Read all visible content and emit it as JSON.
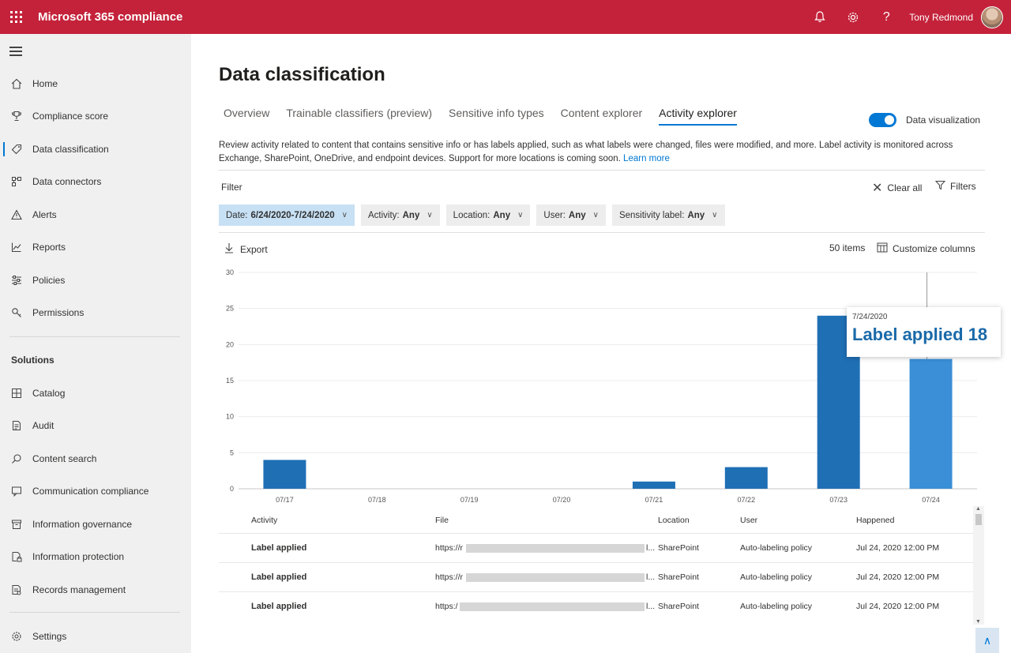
{
  "topbar": {
    "app_title": "Microsoft 365 compliance",
    "user_name": "Tony Redmond",
    "icons": [
      "waffle-icon",
      "bell-icon",
      "gear-icon",
      "help-icon"
    ]
  },
  "sidebar": {
    "items": [
      {
        "label": "Home",
        "icon": "home-icon"
      },
      {
        "label": "Compliance score",
        "icon": "trophy-icon"
      },
      {
        "label": "Data classification",
        "icon": "tag-icon",
        "active": true
      },
      {
        "label": "Data connectors",
        "icon": "connector-icon"
      },
      {
        "label": "Alerts",
        "icon": "warning-icon"
      },
      {
        "label": "Reports",
        "icon": "chart-line-icon"
      },
      {
        "label": "Policies",
        "icon": "sliders-icon"
      },
      {
        "label": "Permissions",
        "icon": "key-icon"
      }
    ],
    "solutions_label": "Solutions",
    "solutions": [
      {
        "label": "Catalog",
        "icon": "catalog-icon"
      },
      {
        "label": "Audit",
        "icon": "audit-icon"
      },
      {
        "label": "Content search",
        "icon": "search-icon"
      },
      {
        "label": "Communication compliance",
        "icon": "chat-icon"
      },
      {
        "label": "Information governance",
        "icon": "archive-icon"
      },
      {
        "label": "Information protection",
        "icon": "lock-doc-icon"
      },
      {
        "label": "Records management",
        "icon": "records-icon"
      }
    ],
    "settings": {
      "label": "Settings",
      "icon": "gear-icon"
    }
  },
  "main": {
    "title": "Data classification",
    "tabs": [
      {
        "label": "Overview"
      },
      {
        "label": "Trainable classifiers (preview)"
      },
      {
        "label": "Sensitive info types"
      },
      {
        "label": "Content explorer"
      },
      {
        "label": "Activity explorer",
        "active": true
      }
    ],
    "toggle_label": "Data visualization",
    "toggle_on": true,
    "description": "Review activity related to content that contains sensitive info or has labels applied, such as what labels were changed, files were modified, and more. Label activity is monitored across Exchange, SharePoint, OneDrive, and endpoint devices. Support for more locations is coming soon.",
    "learn_more": "Learn more",
    "filter_label": "Filter",
    "clear_all": "Clear all",
    "filters": "Filters",
    "chips": [
      {
        "label": "Date:",
        "value": "6/24/2020-7/24/2020"
      },
      {
        "label": "Activity:",
        "value": "Any"
      },
      {
        "label": "Location:",
        "value": "Any"
      },
      {
        "label": "User:",
        "value": "Any"
      },
      {
        "label": "Sensitivity label:",
        "value": "Any"
      }
    ],
    "export": "Export",
    "items_count": "50 items",
    "customize_columns": "Customize columns",
    "tooltip": {
      "date": "7/24/2020",
      "text": "Label applied 18"
    }
  },
  "chart_data": {
    "type": "bar",
    "categories": [
      "07/17",
      "07/18",
      "07/19",
      "07/20",
      "07/21",
      "07/22",
      "07/23",
      "07/24"
    ],
    "values": [
      4,
      0,
      0,
      0,
      1,
      3,
      24,
      18
    ],
    "yticks": [
      0,
      5,
      10,
      15,
      20,
      25,
      30
    ],
    "ylim": [
      0,
      30
    ],
    "grid": true,
    "colors": {
      "bar": "#1f6fb5",
      "highlight": "#3a8fd6"
    }
  },
  "table": {
    "headers": [
      "Activity",
      "File",
      "Location",
      "User",
      "Happened"
    ],
    "rows": [
      {
        "activity": "Label applied",
        "file_start": "https://r",
        "file_end": "l...",
        "location": "SharePoint",
        "user": "Auto-labeling policy",
        "happened": "Jul 24, 2020 12:00 PM"
      },
      {
        "activity": "Label applied",
        "file_start": "https://r",
        "file_end": "l...",
        "location": "SharePoint",
        "user": "Auto-labeling policy",
        "happened": "Jul 24, 2020 12:00 PM"
      },
      {
        "activity": "Label applied",
        "file_start": "https:/",
        "file_end": "l...",
        "location": "SharePoint",
        "user": "Auto-labeling policy",
        "happened": "Jul 24, 2020 12:00 PM"
      }
    ]
  }
}
